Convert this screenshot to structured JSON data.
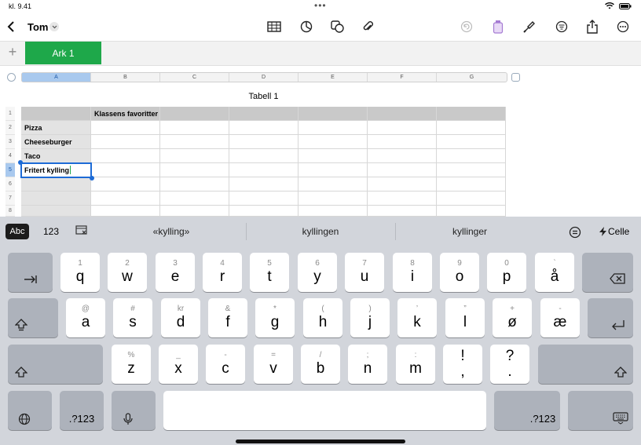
{
  "status": {
    "time": "kl. 9.41",
    "dots": "•••"
  },
  "header": {
    "doc_title": "Tom"
  },
  "sheets": {
    "tabs": [
      "Ark 1"
    ]
  },
  "columns": [
    "A",
    "B",
    "C",
    "D",
    "E",
    "F",
    "G"
  ],
  "table": {
    "title": "Tabell 1",
    "rows": [
      {
        "num": "1",
        "a": "",
        "b": "Klassens favoritter"
      },
      {
        "num": "2",
        "a": "Pizza",
        "b": ""
      },
      {
        "num": "3",
        "a": "Cheeseburger",
        "b": ""
      },
      {
        "num": "4",
        "a": "Taco",
        "b": ""
      },
      {
        "num": "5",
        "a": "Fritert kylling",
        "b": ""
      },
      {
        "num": "6",
        "a": "",
        "b": ""
      },
      {
        "num": "7",
        "a": "",
        "b": ""
      },
      {
        "num": "8",
        "a": "",
        "b": ""
      }
    ]
  },
  "keyboard": {
    "mode_abc": "Abc",
    "mode_123": "123",
    "suggestions": [
      "«kylling»",
      "kyllingen",
      "kyllinger"
    ],
    "cell_label": "Celle",
    "row1": [
      [
        "1",
        "q"
      ],
      [
        "2",
        "w"
      ],
      [
        "3",
        "e"
      ],
      [
        "4",
        "r"
      ],
      [
        "5",
        "t"
      ],
      [
        "6",
        "y"
      ],
      [
        "7",
        "u"
      ],
      [
        "8",
        "i"
      ],
      [
        "9",
        "o"
      ],
      [
        "0",
        "p"
      ],
      [
        "`",
        "å"
      ]
    ],
    "row2": [
      [
        "@",
        "a"
      ],
      [
        "#",
        "s"
      ],
      [
        "kr",
        "d"
      ],
      [
        "&",
        "f"
      ],
      [
        "*",
        "g"
      ],
      [
        "(",
        "h"
      ],
      [
        ")",
        "j"
      ],
      [
        "’",
        "k"
      ],
      [
        "”",
        "l"
      ],
      [
        "+",
        "ø"
      ],
      [
        "-",
        "æ"
      ]
    ],
    "row3": [
      [
        "%",
        "z"
      ],
      [
        "_",
        "x"
      ],
      [
        "-",
        "c"
      ],
      [
        "=",
        "v"
      ],
      [
        "/",
        "b"
      ],
      [
        ";",
        "n"
      ],
      [
        ":",
        "m"
      ],
      [
        "!",
        ","
      ],
      [
        "?",
        "."
      ]
    ],
    "num_label": ".?123"
  }
}
